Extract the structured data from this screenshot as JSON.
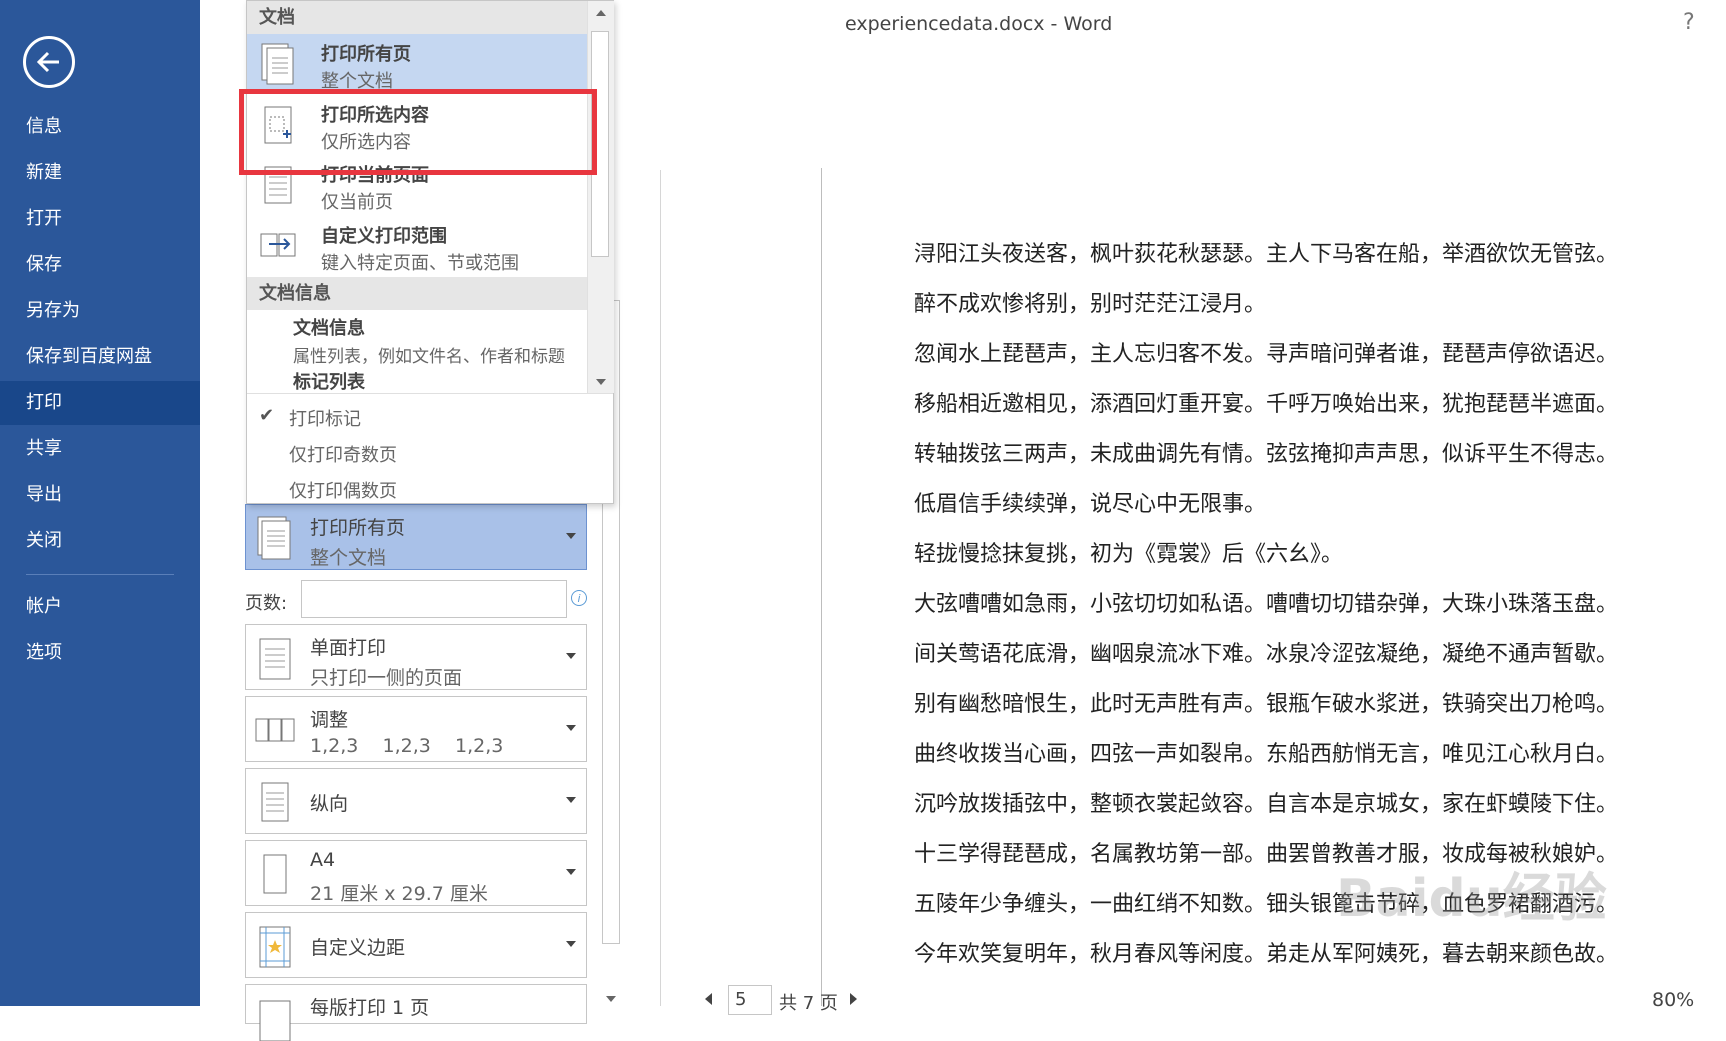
{
  "window": {
    "title": "experiencedata.docx - Word",
    "help": "?"
  },
  "sidebar": {
    "items": [
      {
        "label": "信息"
      },
      {
        "label": "新建"
      },
      {
        "label": "打开"
      },
      {
        "label": "保存"
      },
      {
        "label": "另存为"
      },
      {
        "label": "保存到百度网盘"
      },
      {
        "label": "打印",
        "active": true
      },
      {
        "label": "共享"
      },
      {
        "label": "导出"
      },
      {
        "label": "关闭"
      },
      {
        "label": "帐户"
      },
      {
        "label": "选项"
      }
    ]
  },
  "dropdown": {
    "section_document": "文档",
    "items": [
      {
        "title": "打印所有页",
        "subtitle": "整个文档"
      },
      {
        "title": "打印所选内容",
        "subtitle": "仅所选内容"
      },
      {
        "title": "打印当前页面",
        "subtitle": "仅当前页"
      },
      {
        "title": "自定义打印范围",
        "subtitle": "键入特定页面、节或范围"
      }
    ],
    "section_info": "文档信息",
    "info_title": "文档信息",
    "info_desc": "属性列表，例如文件名、作者和标题",
    "markup_list": "标记列表",
    "options": [
      {
        "label": "打印标记",
        "checked": true
      },
      {
        "label": "仅打印奇数页",
        "checked": false
      },
      {
        "label": "仅打印偶数页",
        "checked": false
      }
    ]
  },
  "settings": {
    "range": {
      "title": "打印所有页",
      "subtitle": "整个文档"
    },
    "pages_label": "页数:",
    "pages_value": "",
    "sides": {
      "title": "单面打印",
      "subtitle": "只打印一侧的页面"
    },
    "collate": {
      "title": "调整",
      "subtitle": "1,2,3    1,2,3    1,2,3"
    },
    "orientation": {
      "title": "纵向"
    },
    "paper": {
      "title": "A4",
      "subtitle": "21 厘米 x 29.7 厘米"
    },
    "margins": {
      "title": "自定义边距"
    },
    "per_sheet": {
      "title": "每版打印 1 页"
    }
  },
  "preview": {
    "lines": [
      "浔阳江头夜送客，枫叶荻花秋瑟瑟。主人下马客在船，举酒欲饮无管弦。",
      "醉不成欢惨将别，别时茫茫江浸月。",
      "忽闻水上琵琶声，主人忘归客不发。寻声暗问弹者谁，琵琶声停欲语迟。",
      "移船相近邀相见，添酒回灯重开宴。千呼万唤始出来，犹抱琵琶半遮面。",
      "转轴拨弦三两声，未成曲调先有情。弦弦掩抑声声思，似诉平生不得志。",
      "低眉信手续续弹，说尽心中无限事。",
      "轻拢慢捻抹复挑，初为《霓裳》后《六幺》。",
      "大弦嘈嘈如急雨，小弦切切如私语。嘈嘈切切错杂弹，大珠小珠落玉盘。",
      "间关莺语花底滑，幽咽泉流冰下难。冰泉冷涩弦凝绝，凝绝不通声暂歇。",
      "别有幽愁暗恨生，此时无声胜有声。银瓶乍破水浆迸，铁骑突出刀枪鸣。",
      "曲终收拨当心画，四弦一声如裂帛。东船西舫悄无言，唯见江心秋月白。",
      "沉吟放拨插弦中，整顿衣裳起敛容。自言本是京城女，家在虾蟆陵下住。",
      "十三学得琵琶成，名属教坊第一部。曲罢曾教善才服，妆成每被秋娘妒。",
      "五陵年少争缠头，一曲红绡不知数。钿头银篦击节碎，血色罗裙翻酒污。",
      "今年欢笑复明年，秋月春风等闲度。弟走从军阿姨死，暮去朝来颜色故。"
    ],
    "watermark": "Baidu经验"
  },
  "footer": {
    "current_page": "5",
    "total_pages": "共 7 页",
    "zoom": "80%"
  },
  "colors": {
    "sidebar": "#2b579a",
    "highlight": "#c5d7f1",
    "selected": "#a9c1e8",
    "annotation": "#e8363f"
  }
}
